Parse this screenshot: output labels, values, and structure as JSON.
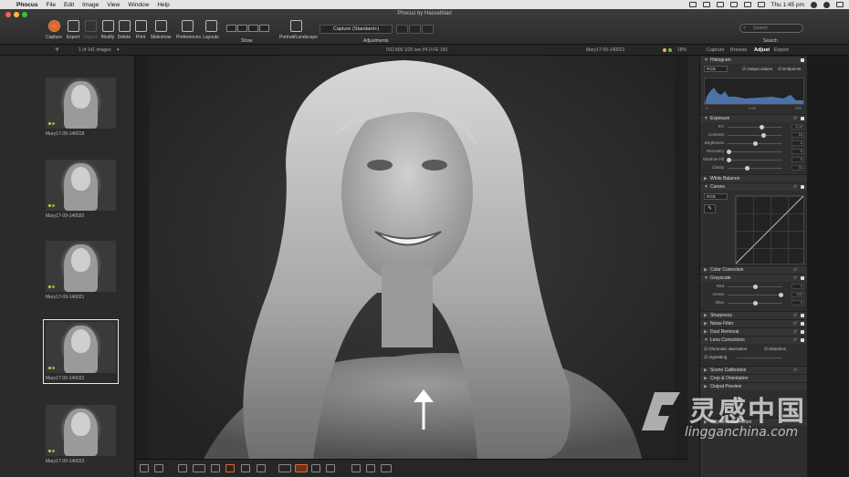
{
  "menubar": {
    "app_name": "Phocus",
    "items": [
      "File",
      "Edit",
      "Image",
      "View",
      "Window",
      "Help"
    ],
    "clock": "Thu 1:45 pm"
  },
  "window": {
    "title": "Phocus by Hasselblad"
  },
  "toolbar": {
    "buttons": [
      "Capture",
      "Export",
      "Import",
      "Modify",
      "Delete",
      "Print",
      "Slideshow",
      "Preferences",
      "Layouts"
    ],
    "show_label": "Show",
    "portrait_label": "Portrait/Landscape",
    "preset_value": "Capture (Standard+)",
    "adjustments_label": "Adjustments",
    "search_placeholder": "Search",
    "search_label": "Search"
  },
  "infobar": {
    "image_count": "1 of 141 images",
    "exif": "ISO 800   1/20 sec   f/4.0   FE 150",
    "filename": "Mary17-09-140022",
    "zoom": "18%"
  },
  "panel_tabs": [
    "Capture",
    "Browse",
    "Adjust",
    "Export"
  ],
  "active_tab": "Adjust",
  "thumbnails": [
    {
      "name": "Mary17-09-140018",
      "selected": false
    },
    {
      "name": "Mary17-09-140020",
      "selected": false
    },
    {
      "name": "Mary17-09-140021",
      "selected": false
    },
    {
      "name": "Mary17-09-140022",
      "selected": true
    },
    {
      "name": "Mary17-09-140023",
      "selected": false
    }
  ],
  "tools": {
    "histogram": {
      "title": "Histogram",
      "channel": "RGB",
      "output_values": "Output values",
      "endpoints": "Endpoints",
      "scale_min": "0",
      "scale_mid": "1.00",
      "scale_max": "255"
    },
    "exposure": {
      "title": "Exposure",
      "sliders": [
        {
          "label": "EV",
          "value": "0.00",
          "pos": 0.62
        },
        {
          "label": "Contrast",
          "value": "15",
          "pos": 0.66
        },
        {
          "label": "Brightness",
          "value": "0",
          "pos": 0.5
        },
        {
          "label": "Recovery",
          "value": "0",
          "pos": 0.02
        },
        {
          "label": "Shadow Fill",
          "value": "0",
          "pos": 0.02
        },
        {
          "label": "Clarity",
          "value": "31",
          "pos": 0.35
        }
      ]
    },
    "white_balance": "White Balance",
    "curves": {
      "title": "Curves",
      "channel": "RGB"
    },
    "color_correction": "Color Correction",
    "grayscale": {
      "title": "Grayscale",
      "sliders": [
        {
          "label": "Red",
          "value": "0",
          "pos": 0.5
        },
        {
          "label": "Green",
          "value": "100",
          "pos": 0.98
        },
        {
          "label": "Blue",
          "value": "0",
          "pos": 0.5
        }
      ]
    },
    "sharpness": "Sharpness",
    "noise_filter": "Noise Filter",
    "dust_removal": "Dust Removal",
    "lens_corrections": {
      "title": "Lens Corrections",
      "chromatic": "Chromatic aberration",
      "distortion": "Distortion",
      "vignetting": "Vignetting"
    },
    "scene_calibration": "Scene Calibration",
    "crop": "Crop & Orientation",
    "output_preview": "Output Preview",
    "keystone": "Keystone Correction"
  },
  "watermark": {
    "text": "灵感中国",
    "url": "lingganchina.com"
  },
  "colors": {
    "accent": "#e06a2c",
    "panel": "#2e2e2e",
    "viewer": "#1f1f1f"
  }
}
